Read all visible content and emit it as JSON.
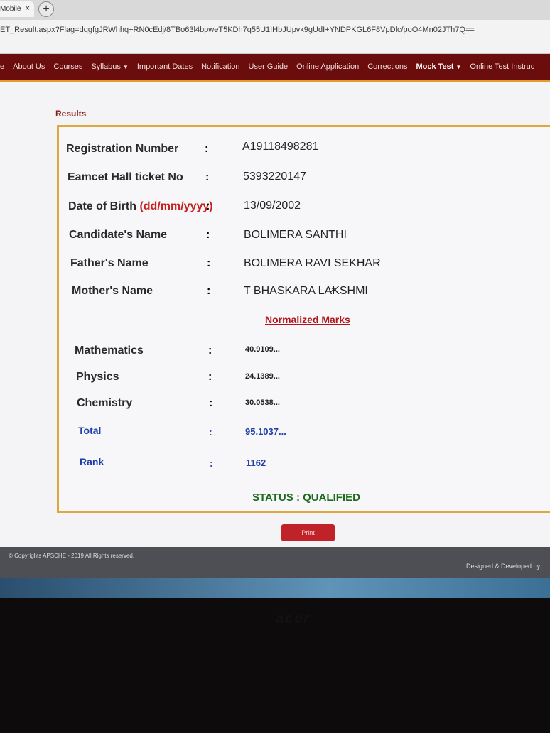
{
  "browser": {
    "tab_label": "Mobile",
    "tab_close": "×",
    "new_tab": "+",
    "url": "ET_Result.aspx?Flag=dqgfgJRWhhq+RN0cEdj/8TBo63l4bpweT5KDh7q55U1IHbJUpvk9gUdI+YNDPKGL6F8VpDlc/poO4Mn02JTh7Q=="
  },
  "nav": {
    "items": [
      {
        "label": "e"
      },
      {
        "label": "About Us"
      },
      {
        "label": "Courses"
      },
      {
        "label": "Syllabus",
        "dropdown": true
      },
      {
        "label": "Important Dates"
      },
      {
        "label": "Notification"
      },
      {
        "label": "User Guide"
      },
      {
        "label": "Online Application"
      },
      {
        "label": "Corrections"
      },
      {
        "label": "Mock Test",
        "dropdown": true,
        "bold": true
      },
      {
        "label": "Online Test Instruc"
      }
    ]
  },
  "results": {
    "heading": "Results",
    "fields": {
      "registration_number": {
        "label": "Registration Number",
        "value": "A19118498281"
      },
      "hall_ticket": {
        "label": "Eamcet Hall ticket No",
        "value": "5393220147"
      },
      "dob": {
        "label": "Date of Birth",
        "format": "(dd/mm/yyyy)",
        "value": "13/09/2002"
      },
      "candidate_name": {
        "label": "Candidate's Name",
        "value": "BOLIMERA SANTHI"
      },
      "father_name": {
        "label": "Father's Name",
        "value": "BOLIMERA RAVI SEKHAR"
      },
      "mother_name": {
        "label": "Mother's Name",
        "value": "T BHASKARA LAKSHMI"
      }
    },
    "colon": ":",
    "normalized_title": "Normalized Marks",
    "marks": {
      "mathematics": {
        "label": "Mathematics",
        "value": "40.9109..."
      },
      "physics": {
        "label": "Physics",
        "value": "24.1389..."
      },
      "chemistry": {
        "label": "Chemistry",
        "value": "30.0538..."
      },
      "total": {
        "label": "Total",
        "value": "95.1037..."
      },
      "rank": {
        "label": "Rank",
        "value": "1162"
      }
    },
    "status": "STATUS : QUALIFIED",
    "print_label": "Print"
  },
  "footer": {
    "copyright": "© Copyrights APSCHE - 2019 All Rights reserved.",
    "designed": "Designed & Developed by"
  },
  "colors": {
    "nav_bg": "#6b0d0d",
    "accent_border": "#e0a640",
    "section_red": "#b1151a",
    "total_blue": "#1f3fa8",
    "status_green": "#1d6a1d"
  }
}
